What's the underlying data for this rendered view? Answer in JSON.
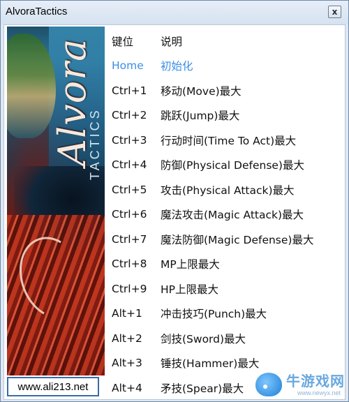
{
  "window": {
    "title": "AlvoraTactics",
    "close_label": "x"
  },
  "banner": {
    "logo": "Alvora",
    "logo_sub": "TACTICS"
  },
  "site_box": {
    "text": "www.ali213.net"
  },
  "list": {
    "header": {
      "key": "键位",
      "desc": "说明"
    },
    "rows": [
      {
        "key": "Home",
        "desc": "初始化",
        "highlight": true
      },
      {
        "key": "Ctrl+1",
        "desc": "移动(Move)最大"
      },
      {
        "key": "Ctrl+2",
        "desc": "跳跃(Jump)最大"
      },
      {
        "key": "Ctrl+3",
        "desc": "行动时间(Time To Act)最大"
      },
      {
        "key": "Ctrl+4",
        "desc": "防御(Physical Defense)最大"
      },
      {
        "key": "Ctrl+5",
        "desc": "攻击(Physical Attack)最大"
      },
      {
        "key": "Ctrl+6",
        "desc": "魔法攻击(Magic Attack)最大"
      },
      {
        "key": "Ctrl+7",
        "desc": "魔法防御(Magic Defense)最大"
      },
      {
        "key": "Ctrl+8",
        "desc": "MP上限最大"
      },
      {
        "key": "Ctrl+9",
        "desc": "HP上限最大"
      },
      {
        "key": "Alt+1",
        "desc": "冲击技巧(Punch)最大"
      },
      {
        "key": "Alt+2",
        "desc": "剑技(Sword)最大"
      },
      {
        "key": "Alt+3",
        "desc": "锤技(Hammer)最大"
      },
      {
        "key": "Alt+4",
        "desc": "矛技(Spear)最大"
      }
    ]
  },
  "watermark": {
    "text": "牛游戏网",
    "url": "www.newyx.net"
  },
  "colors": {
    "highlight": "#3a8ee6",
    "titlebar": "#dfe8f3",
    "site_box_border": "#3a6aa8"
  }
}
